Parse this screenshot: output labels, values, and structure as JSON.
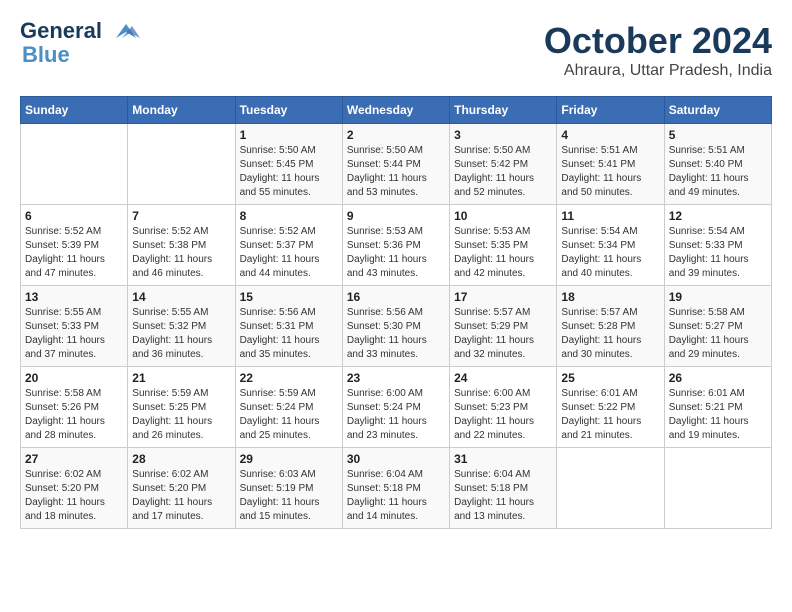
{
  "logo": {
    "line1": "General",
    "line2": "Blue"
  },
  "title": "October 2024",
  "subtitle": "Ahraura, Uttar Pradesh, India",
  "headers": [
    "Sunday",
    "Monday",
    "Tuesday",
    "Wednesday",
    "Thursday",
    "Friday",
    "Saturday"
  ],
  "weeks": [
    [
      {
        "day": "",
        "sunrise": "",
        "sunset": "",
        "daylight": ""
      },
      {
        "day": "",
        "sunrise": "",
        "sunset": "",
        "daylight": ""
      },
      {
        "day": "1",
        "sunrise": "Sunrise: 5:50 AM",
        "sunset": "Sunset: 5:45 PM",
        "daylight": "Daylight: 11 hours and 55 minutes."
      },
      {
        "day": "2",
        "sunrise": "Sunrise: 5:50 AM",
        "sunset": "Sunset: 5:44 PM",
        "daylight": "Daylight: 11 hours and 53 minutes."
      },
      {
        "day": "3",
        "sunrise": "Sunrise: 5:50 AM",
        "sunset": "Sunset: 5:42 PM",
        "daylight": "Daylight: 11 hours and 52 minutes."
      },
      {
        "day": "4",
        "sunrise": "Sunrise: 5:51 AM",
        "sunset": "Sunset: 5:41 PM",
        "daylight": "Daylight: 11 hours and 50 minutes."
      },
      {
        "day": "5",
        "sunrise": "Sunrise: 5:51 AM",
        "sunset": "Sunset: 5:40 PM",
        "daylight": "Daylight: 11 hours and 49 minutes."
      }
    ],
    [
      {
        "day": "6",
        "sunrise": "Sunrise: 5:52 AM",
        "sunset": "Sunset: 5:39 PM",
        "daylight": "Daylight: 11 hours and 47 minutes."
      },
      {
        "day": "7",
        "sunrise": "Sunrise: 5:52 AM",
        "sunset": "Sunset: 5:38 PM",
        "daylight": "Daylight: 11 hours and 46 minutes."
      },
      {
        "day": "8",
        "sunrise": "Sunrise: 5:52 AM",
        "sunset": "Sunset: 5:37 PM",
        "daylight": "Daylight: 11 hours and 44 minutes."
      },
      {
        "day": "9",
        "sunrise": "Sunrise: 5:53 AM",
        "sunset": "Sunset: 5:36 PM",
        "daylight": "Daylight: 11 hours and 43 minutes."
      },
      {
        "day": "10",
        "sunrise": "Sunrise: 5:53 AM",
        "sunset": "Sunset: 5:35 PM",
        "daylight": "Daylight: 11 hours and 42 minutes."
      },
      {
        "day": "11",
        "sunrise": "Sunrise: 5:54 AM",
        "sunset": "Sunset: 5:34 PM",
        "daylight": "Daylight: 11 hours and 40 minutes."
      },
      {
        "day": "12",
        "sunrise": "Sunrise: 5:54 AM",
        "sunset": "Sunset: 5:33 PM",
        "daylight": "Daylight: 11 hours and 39 minutes."
      }
    ],
    [
      {
        "day": "13",
        "sunrise": "Sunrise: 5:55 AM",
        "sunset": "Sunset: 5:33 PM",
        "daylight": "Daylight: 11 hours and 37 minutes."
      },
      {
        "day": "14",
        "sunrise": "Sunrise: 5:55 AM",
        "sunset": "Sunset: 5:32 PM",
        "daylight": "Daylight: 11 hours and 36 minutes."
      },
      {
        "day": "15",
        "sunrise": "Sunrise: 5:56 AM",
        "sunset": "Sunset: 5:31 PM",
        "daylight": "Daylight: 11 hours and 35 minutes."
      },
      {
        "day": "16",
        "sunrise": "Sunrise: 5:56 AM",
        "sunset": "Sunset: 5:30 PM",
        "daylight": "Daylight: 11 hours and 33 minutes."
      },
      {
        "day": "17",
        "sunrise": "Sunrise: 5:57 AM",
        "sunset": "Sunset: 5:29 PM",
        "daylight": "Daylight: 11 hours and 32 minutes."
      },
      {
        "day": "18",
        "sunrise": "Sunrise: 5:57 AM",
        "sunset": "Sunset: 5:28 PM",
        "daylight": "Daylight: 11 hours and 30 minutes."
      },
      {
        "day": "19",
        "sunrise": "Sunrise: 5:58 AM",
        "sunset": "Sunset: 5:27 PM",
        "daylight": "Daylight: 11 hours and 29 minutes."
      }
    ],
    [
      {
        "day": "20",
        "sunrise": "Sunrise: 5:58 AM",
        "sunset": "Sunset: 5:26 PM",
        "daylight": "Daylight: 11 hours and 28 minutes."
      },
      {
        "day": "21",
        "sunrise": "Sunrise: 5:59 AM",
        "sunset": "Sunset: 5:25 PM",
        "daylight": "Daylight: 11 hours and 26 minutes."
      },
      {
        "day": "22",
        "sunrise": "Sunrise: 5:59 AM",
        "sunset": "Sunset: 5:24 PM",
        "daylight": "Daylight: 11 hours and 25 minutes."
      },
      {
        "day": "23",
        "sunrise": "Sunrise: 6:00 AM",
        "sunset": "Sunset: 5:24 PM",
        "daylight": "Daylight: 11 hours and 23 minutes."
      },
      {
        "day": "24",
        "sunrise": "Sunrise: 6:00 AM",
        "sunset": "Sunset: 5:23 PM",
        "daylight": "Daylight: 11 hours and 22 minutes."
      },
      {
        "day": "25",
        "sunrise": "Sunrise: 6:01 AM",
        "sunset": "Sunset: 5:22 PM",
        "daylight": "Daylight: 11 hours and 21 minutes."
      },
      {
        "day": "26",
        "sunrise": "Sunrise: 6:01 AM",
        "sunset": "Sunset: 5:21 PM",
        "daylight": "Daylight: 11 hours and 19 minutes."
      }
    ],
    [
      {
        "day": "27",
        "sunrise": "Sunrise: 6:02 AM",
        "sunset": "Sunset: 5:20 PM",
        "daylight": "Daylight: 11 hours and 18 minutes."
      },
      {
        "day": "28",
        "sunrise": "Sunrise: 6:02 AM",
        "sunset": "Sunset: 5:20 PM",
        "daylight": "Daylight: 11 hours and 17 minutes."
      },
      {
        "day": "29",
        "sunrise": "Sunrise: 6:03 AM",
        "sunset": "Sunset: 5:19 PM",
        "daylight": "Daylight: 11 hours and 15 minutes."
      },
      {
        "day": "30",
        "sunrise": "Sunrise: 6:04 AM",
        "sunset": "Sunset: 5:18 PM",
        "daylight": "Daylight: 11 hours and 14 minutes."
      },
      {
        "day": "31",
        "sunrise": "Sunrise: 6:04 AM",
        "sunset": "Sunset: 5:18 PM",
        "daylight": "Daylight: 11 hours and 13 minutes."
      },
      {
        "day": "",
        "sunrise": "",
        "sunset": "",
        "daylight": ""
      },
      {
        "day": "",
        "sunrise": "",
        "sunset": "",
        "daylight": ""
      }
    ]
  ]
}
